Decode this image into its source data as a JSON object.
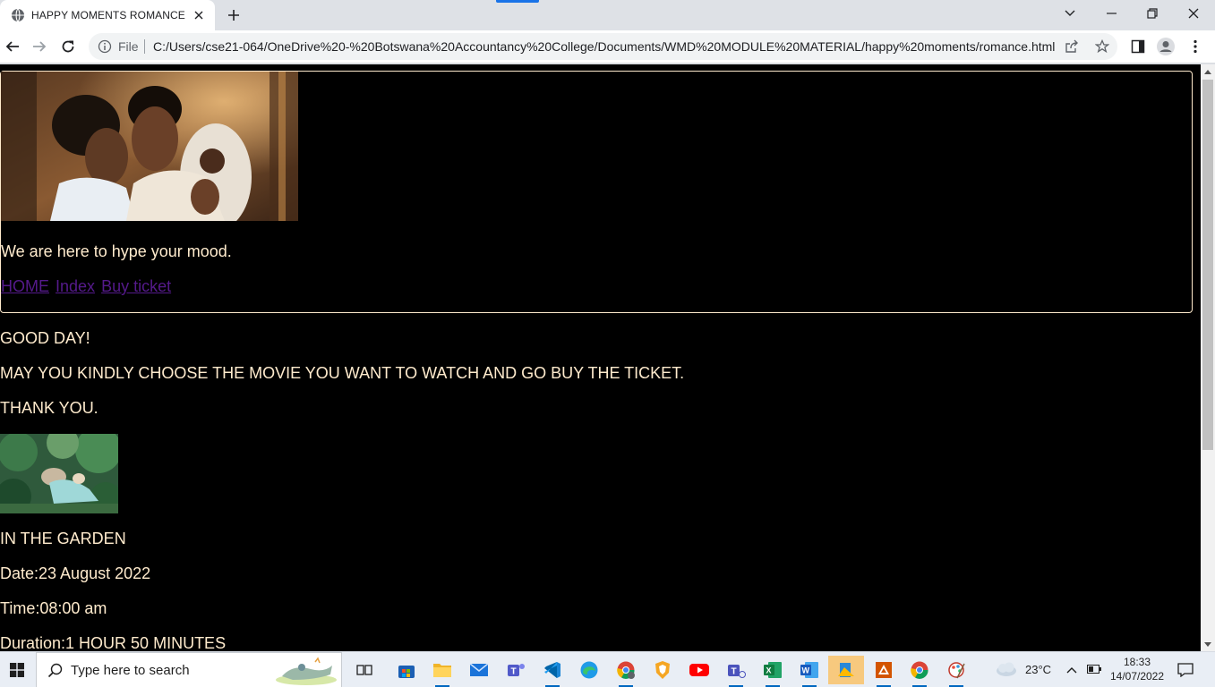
{
  "browser": {
    "tab_title": "HAPPY MOMENTS ROMANCE",
    "file_chip": "File",
    "url": "C:/Users/cse21-064/OneDrive%20-%20Botswana%20Accountancy%20College/Documents/WMD%20MODULE%20MATERIAL/happy%20moments/romance.html"
  },
  "page": {
    "tagline": "We are here to hype your mood.",
    "nav": [
      {
        "label": "HOME"
      },
      {
        "label": "Index"
      },
      {
        "label": "Buy ticket"
      }
    ],
    "greeting": "GOOD DAY!",
    "instruction": "MAY YOU KINDLY CHOOSE THE MOVIE YOU WANT TO WATCH AND GO BUY THE TICKET.",
    "thanks": "THANK YOU.",
    "movie": {
      "title": "IN THE GARDEN",
      "date": "Date:23 August 2022",
      "time": "Time:08:00 am",
      "duration": "Duration:1 HOUR 50 MINUTES"
    }
  },
  "taskbar": {
    "search_placeholder": "Type here to search",
    "weather": "23°C",
    "time": "18:33",
    "date": "14/07/2022",
    "apps": [
      "task-view",
      "store",
      "file-explorer",
      "mail",
      "teams",
      "vscode",
      "edge",
      "chrome-profile",
      "brave",
      "youtube",
      "teams-work",
      "excel",
      "word",
      "sticky",
      "office-app",
      "chrome",
      "paint"
    ]
  },
  "colors": {
    "page_bg": "#000000",
    "page_text": "#ffebcd",
    "link": "#551a8b"
  }
}
